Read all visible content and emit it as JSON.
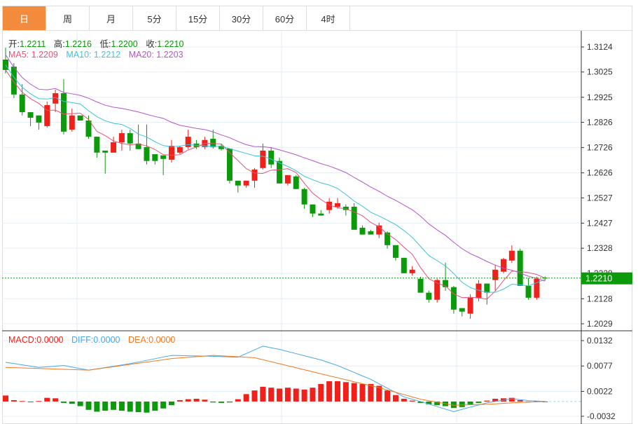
{
  "tabs": [
    "日",
    "周",
    "月",
    "5分",
    "15分",
    "30分",
    "60分",
    "4时"
  ],
  "active_tab": 0,
  "ohlc_legend": {
    "open_label": "开:",
    "open": "1.2211",
    "high_label": "高:",
    "high": "1.2216",
    "low_label": "低:",
    "low": "1.2200",
    "close_label": "收:",
    "close": "1.2210"
  },
  "ma_legend": {
    "ma5": "MA5: 1.2209",
    "ma10": "MA10: 1.2212",
    "ma20": "MA20: 1.2203"
  },
  "macd_legend": {
    "macd": "MACD:0.0000",
    "diff": "DIFF:0.0000",
    "dea": "DEA:0.0000"
  },
  "current_price": "1.2210",
  "colors": {
    "up": "#f0201a",
    "down": "#0a9a0a",
    "ma5": "#e8507a",
    "ma10": "#3cc3dc",
    "ma20": "#b455c8",
    "diff": "#4aa8e8",
    "dea": "#f07a20",
    "accent": "#f28c3c"
  },
  "chart_data": [
    {
      "type": "candlestick",
      "title": "Daily",
      "y_ticks": [
        "1.3124",
        "1.3025",
        "1.2925",
        "1.2826",
        "1.2726",
        "1.2626",
        "1.2527",
        "1.2427",
        "1.2328",
        "1.2228",
        "1.2128",
        "1.2029"
      ],
      "ylim": [
        1.2029,
        1.3124
      ],
      "candles": [
        [
          1.3074,
          1.3121,
          1.3019,
          1.3033
        ],
        [
          1.3046,
          1.306,
          1.2922,
          1.2936
        ],
        [
          1.2936,
          1.2977,
          1.2853,
          1.2866
        ],
        [
          1.2866,
          1.2866,
          1.2811,
          1.2844
        ],
        [
          1.2853,
          1.2853,
          1.2797,
          1.2825
        ],
        [
          1.2811,
          1.2908,
          1.2805,
          1.2894
        ],
        [
          1.29,
          1.2955,
          1.2866,
          1.2941
        ],
        [
          1.2941,
          1.2997,
          1.2778,
          1.2789
        ],
        [
          1.2797,
          1.288,
          1.2789,
          1.2853
        ],
        [
          1.2853,
          1.2853,
          1.2833,
          1.2833
        ],
        [
          1.2833,
          1.2853,
          1.2761,
          1.2769
        ],
        [
          1.2769,
          1.2769,
          1.2686,
          1.2706
        ],
        [
          1.2714,
          1.2714,
          1.2623,
          1.2706
        ],
        [
          1.2706,
          1.2769,
          1.2706,
          1.2747
        ],
        [
          1.2747,
          1.2797,
          1.2714,
          1.2783
        ],
        [
          1.2783,
          1.2797,
          1.2714,
          1.2742
        ],
        [
          1.2742,
          1.2817,
          1.272,
          1.272
        ],
        [
          1.2728,
          1.2817,
          1.2659,
          1.2673
        ],
        [
          1.27,
          1.27,
          1.2659,
          1.2673
        ],
        [
          1.2695,
          1.2695,
          1.2617,
          1.2681
        ],
        [
          1.2678,
          1.2756,
          1.2667,
          1.2733
        ],
        [
          1.2706,
          1.2733,
          1.27,
          1.2728
        ],
        [
          1.2728,
          1.2797,
          1.272,
          1.2769
        ],
        [
          1.2742,
          1.2756,
          1.272,
          1.2728
        ],
        [
          1.2728,
          1.2769,
          1.272,
          1.2756
        ],
        [
          1.2761,
          1.2797,
          1.2722,
          1.2728
        ],
        [
          1.2733,
          1.2742,
          1.2714,
          1.272
        ],
        [
          1.2722,
          1.2722,
          1.2584,
          1.2595
        ],
        [
          1.2595,
          1.2595,
          1.2548,
          1.2576
        ],
        [
          1.2576,
          1.2595,
          1.2567,
          1.2595
        ],
        [
          1.2595,
          1.2645,
          1.2567,
          1.2639
        ],
        [
          1.2645,
          1.2742,
          1.2639,
          1.2714
        ],
        [
          1.2714,
          1.2728,
          1.2645,
          1.2659
        ],
        [
          1.2673,
          1.2686,
          1.2584,
          1.2584
        ],
        [
          1.2584,
          1.2617,
          1.2576,
          1.2617
        ],
        [
          1.2612,
          1.2617,
          1.2562,
          1.2562
        ],
        [
          1.2562,
          1.2567,
          1.2484,
          1.2501
        ],
        [
          1.2501,
          1.2501,
          1.2451,
          1.2465
        ],
        [
          1.2465,
          1.2479,
          1.2457,
          1.2457
        ],
        [
          1.2479,
          1.2526,
          1.2465,
          1.2512
        ],
        [
          1.2492,
          1.2526,
          1.2484,
          1.2506
        ],
        [
          1.2492,
          1.2501,
          1.2457,
          1.2479
        ],
        [
          1.2492,
          1.2506,
          1.2401,
          1.2401
        ],
        [
          1.2409,
          1.2418,
          1.2382,
          1.2382
        ],
        [
          1.2395,
          1.2401,
          1.2382,
          1.2382
        ],
        [
          1.2382,
          1.2429,
          1.2368,
          1.2418
        ],
        [
          1.239,
          1.2395,
          1.2326,
          1.234
        ],
        [
          1.234,
          1.234,
          1.2279,
          1.229
        ],
        [
          1.229,
          1.229,
          1.2229,
          1.2229
        ],
        [
          1.2229,
          1.2257,
          1.222,
          1.2243
        ],
        [
          1.2207,
          1.2215,
          1.2152,
          1.2152
        ],
        [
          1.2152,
          1.216,
          1.2113,
          1.2124
        ],
        [
          1.2124,
          1.2207,
          1.2113,
          1.2202
        ],
        [
          1.2202,
          1.2271,
          1.216,
          1.2174
        ],
        [
          1.2174,
          1.2179,
          1.2069,
          1.2085
        ],
        [
          1.2091,
          1.2091,
          1.2058,
          1.2077
        ],
        [
          1.2069,
          1.2146,
          1.2049,
          1.2132
        ],
        [
          1.2132,
          1.2202,
          1.2118,
          1.2188
        ],
        [
          1.2188,
          1.2188,
          1.2105,
          1.2152
        ],
        [
          1.2202,
          1.2263,
          1.216,
          1.2243
        ],
        [
          1.2235,
          1.229,
          1.2229,
          1.2285
        ],
        [
          1.2279,
          1.234,
          1.227,
          1.2318
        ],
        [
          1.2318,
          1.2326,
          1.2179,
          1.2179
        ],
        [
          1.2179,
          1.221,
          1.2124,
          1.2132
        ],
        [
          1.2132,
          1.2215,
          1.2124,
          1.2207
        ],
        [
          1.2211,
          1.2216,
          1.22,
          1.221
        ]
      ]
    },
    {
      "type": "macd",
      "y_ticks": [
        "0.0132",
        "0.0077",
        "0.0022",
        "-0.0032"
      ],
      "ylim": [
        -0.0032,
        0.0132
      ],
      "histogram_e4": [
        13,
        3,
        1,
        -1,
        1,
        8,
        7,
        -3,
        -5,
        -10,
        -18,
        -22,
        -20,
        -18,
        -20,
        -22,
        -23,
        -24,
        -20,
        -15,
        -8,
        3,
        5,
        6,
        4,
        -2,
        -3,
        -2,
        5,
        16,
        24,
        32,
        30,
        28,
        30,
        28,
        26,
        30,
        38,
        44,
        44,
        42,
        40,
        38,
        38,
        34,
        24,
        14,
        6,
        2,
        -3,
        -6,
        -8,
        -10,
        -14,
        -12,
        -6,
        -3,
        2,
        6,
        7,
        8,
        3,
        0,
        1,
        0
      ],
      "diff_anchors": [
        [
          0,
          0.0085
        ],
        [
          4,
          0.0074
        ],
        [
          7,
          0.0078
        ],
        [
          10,
          0.0068
        ],
        [
          15,
          0.0082
        ],
        [
          20,
          0.01
        ],
        [
          25,
          0.0098
        ],
        [
          28,
          0.0096
        ],
        [
          30,
          0.0112
        ],
        [
          31,
          0.012
        ],
        [
          33,
          0.0113
        ],
        [
          38,
          0.009
        ],
        [
          40,
          0.0078
        ],
        [
          44,
          0.0048
        ],
        [
          48,
          0.001
        ],
        [
          50,
          0.0
        ],
        [
          54,
          -0.0022
        ],
        [
          56,
          -0.0012
        ],
        [
          58,
          -0.0003
        ],
        [
          61,
          0.0006
        ],
        [
          63,
          0.0002
        ],
        [
          65,
          0.0
        ]
      ],
      "dea_anchors": [
        [
          0,
          0.0074
        ],
        [
          10,
          0.0068
        ],
        [
          20,
          0.0093
        ],
        [
          25,
          0.01
        ],
        [
          30,
          0.0095
        ],
        [
          38,
          0.006
        ],
        [
          45,
          0.003
        ],
        [
          50,
          0.0005
        ],
        [
          54,
          -0.0008
        ],
        [
          58,
          -0.0006
        ],
        [
          62,
          -0.0002
        ],
        [
          65,
          0.0
        ]
      ]
    }
  ]
}
